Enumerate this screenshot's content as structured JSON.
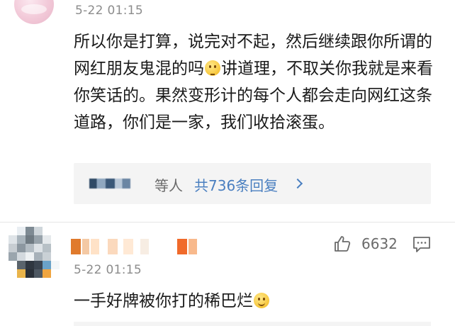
{
  "comment1": {
    "timestamp": "5-22 01:15",
    "text_part1": "所以你是打算，说完对不起，然后继续跟你所谓的网红朋友鬼混的吗",
    "text_part2": "讲道理，不取关你我就是来看你笑话的。果然变形计的每个人都会走向网红这条道路，你们是一家，我们收拾滚蛋。",
    "emoji_icon": "thinking-face-icon",
    "replies": {
      "suffix": "等人",
      "link": "共736条回复"
    }
  },
  "comment2": {
    "timestamp": "5-22 01:15",
    "text": "一手好牌被你打的稀巴烂",
    "emoji_icon": "smile-face-icon",
    "likes": "6632"
  },
  "colors": {
    "link": "#4a7fc0",
    "meta": "#8c8c8c",
    "reply_bg": "#f4f4f4"
  }
}
